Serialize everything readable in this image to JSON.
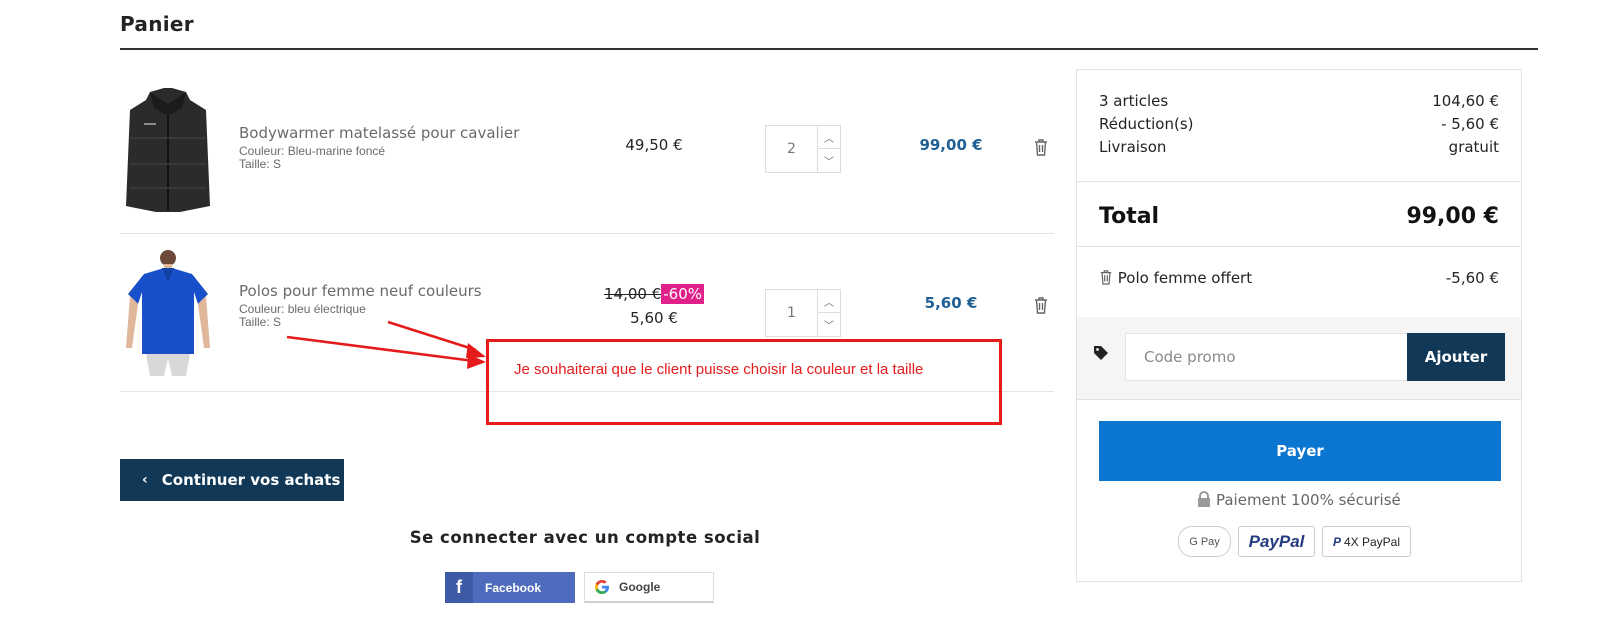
{
  "page": {
    "title": "Panier"
  },
  "cart": {
    "items": [
      {
        "name": "Bodywarmer matelassé pour cavalier",
        "color": "Couleur: Bleu-marine foncé",
        "size": "Taille: S",
        "unit_price": "49,50 €",
        "quantity": "2",
        "line_total": "99,00 €"
      },
      {
        "name": "Polos pour femme neuf couleurs",
        "color": "Couleur: bleu électrique",
        "size": "Taille: S",
        "old_price": "14,00 €",
        "discount": "-60%",
        "unit_price": "5,60 €",
        "quantity": "1",
        "line_total": "5,60 €"
      }
    ],
    "continue_label": "Continuer vos achats"
  },
  "social": {
    "title": "Se connecter avec un compte social",
    "facebook_label": "Facebook",
    "google_label": "Google"
  },
  "summary": {
    "articles_label": "3 articles",
    "articles_value": "104,60 €",
    "reduction_label": "Réduction(s)",
    "reduction_value": "- 5,60 €",
    "shipping_label": "Livraison",
    "shipping_value": "gratuit",
    "total_label": "Total",
    "total_value": "99,00 €",
    "offer_label": "Polo femme offert",
    "offer_value": "-5,60 €",
    "promo_placeholder": "Code promo",
    "promo_button": "Ajouter",
    "pay_button": "Payer",
    "secure_text": "Paiement 100% sécurisé",
    "payment_methods": [
      "G Pay",
      "PayPal",
      "4X PayPal"
    ]
  },
  "annotation": {
    "text": "Je souhaiterai que le client puisse choisir la couleur et la taille",
    "color": "#e51b1b"
  },
  "colors": {
    "accent_dark": "#113856",
    "pay_blue": "#0b76d0",
    "price_blue": "#1f5f94",
    "discount_pink": "#e0218a"
  }
}
